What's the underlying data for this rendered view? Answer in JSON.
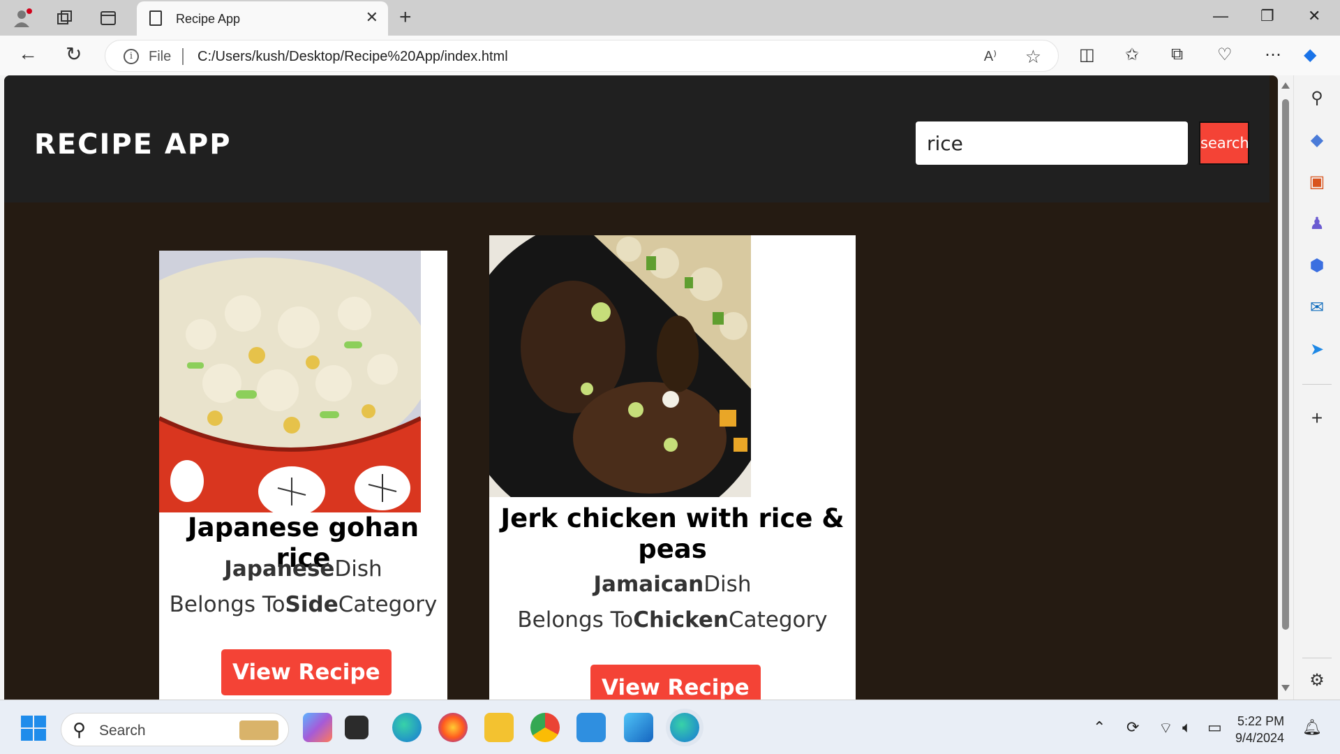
{
  "browser": {
    "tab_title": "Recipe App",
    "address_prefix": "File",
    "url": "C:/Users/kush/Desktop/Recipe%20App/index.html"
  },
  "app": {
    "title": "RECIPE APP",
    "search_value": "rice",
    "search_button": "search"
  },
  "recipes": [
    {
      "name": "Japanese gohan rice",
      "area": "Japanese",
      "dish_suffix": "Dish",
      "category_prefix": "Belongs To",
      "category": "Side",
      "category_suffix": "Category",
      "button": "View Recipe"
    },
    {
      "name": "Jerk chicken with rice & peas",
      "area": "Jamaican",
      "dish_suffix": "Dish",
      "category_prefix": "Belongs To",
      "category": "Chicken",
      "category_suffix": "Category",
      "button": "View Recipe"
    }
  ],
  "taskbar": {
    "search_label": "Search",
    "time": "5:22 PM",
    "date": "9/4/2024"
  },
  "colors": {
    "accent_red": "#f44336",
    "header_bg": "#202020",
    "page_bg": "#251b12"
  }
}
